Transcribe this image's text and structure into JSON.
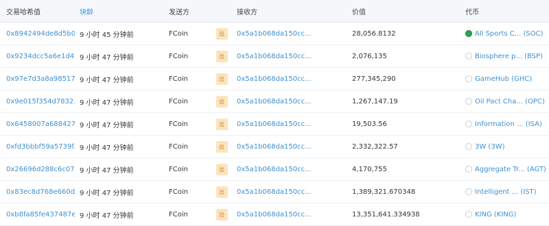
{
  "headers": {
    "hash": "交易哈希值",
    "age": "块龄",
    "from": "发送方",
    "to": "接收方",
    "value": "价值",
    "token": "代币"
  },
  "rows": [
    {
      "hash": "0x8942494de8d5b0...",
      "age": "9 小时 45 分钟前",
      "from": "FCoin",
      "dir": "出",
      "to": "0x5a1b068da150cc...",
      "value": "28,056.8132",
      "token": "All Sports C... (SOC)",
      "token_icon": "green"
    },
    {
      "hash": "0x9234dcc5a6e1d4...",
      "age": "9 小时 47 分钟前",
      "from": "FCoin",
      "dir": "出",
      "to": "0x5a1b068da150cc...",
      "value": "2,076,135",
      "token": "Biosphere p... (BSP)",
      "token_icon": "gray"
    },
    {
      "hash": "0x97e7d3a8a98517...",
      "age": "9 小时 47 分钟前",
      "from": "FCoin",
      "dir": "出",
      "to": "0x5a1b068da150cc...",
      "value": "277,345,290",
      "token": "GameHub (GHC)",
      "token_icon": "gray"
    },
    {
      "hash": "0x9e015f354d7832...",
      "age": "9 小时 47 分钟前",
      "from": "FCoin",
      "dir": "出",
      "to": "0x5a1b068da150cc...",
      "value": "1,267,147.19",
      "token": "Oil Pact Cha... (OPC)",
      "token_icon": "gray"
    },
    {
      "hash": "0x6458007a688427...",
      "age": "9 小时 47 分钟前",
      "from": "FCoin",
      "dir": "出",
      "to": "0x5a1b068da150cc...",
      "value": "19,503.56",
      "token": "Information ... (ISA)",
      "token_icon": "gray"
    },
    {
      "hash": "0xfd3bbbf59a5739f...",
      "age": "9 小时 47 分钟前",
      "from": "FCoin",
      "dir": "出",
      "to": "0x5a1b068da150cc...",
      "value": "2,332,322.57",
      "token": "3W (3W)",
      "token_icon": "gray"
    },
    {
      "hash": "0x26696d288c6c07...",
      "age": "9 小时 47 分钟前",
      "from": "FCoin",
      "dir": "出",
      "to": "0x5a1b068da150cc...",
      "value": "4,170,755",
      "token": "Aggregate Tr... (AGT)",
      "token_icon": "gray"
    },
    {
      "hash": "0x83ec8d768e660d...",
      "age": "9 小时 47 分钟前",
      "from": "FCoin",
      "dir": "出",
      "to": "0x5a1b068da150cc...",
      "value": "1,389,321.670348",
      "token": "Intelligent ... (IST)",
      "token_icon": "gray"
    },
    {
      "hash": "0xb8fa85fe437487e...",
      "age": "9 小时 47 分钟前",
      "from": "FCoin",
      "dir": "出",
      "to": "0x5a1b068da150cc...",
      "value": "13,351,641.334938",
      "token": "KING (KING)",
      "token_icon": "gray"
    }
  ]
}
